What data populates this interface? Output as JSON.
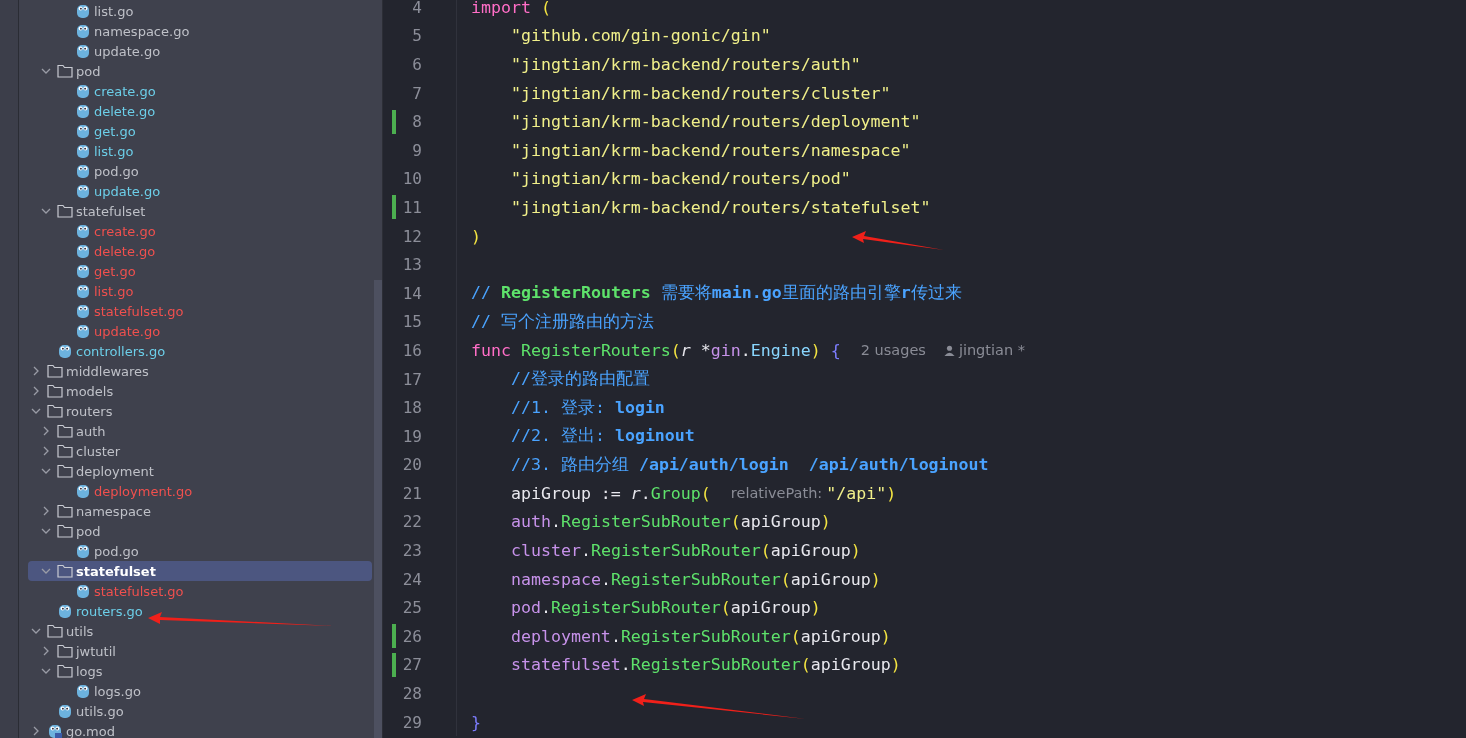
{
  "tree": {
    "items": [
      {
        "kind": "group",
        "children": [
          {
            "kind": "group",
            "children": [
              {
                "kind": "file",
                "name": "list.go",
                "color": "#bfc1c8",
                "selected": false
              },
              {
                "kind": "file",
                "name": "namespace.go",
                "color": "#bfc1c8",
                "selected": false
              },
              {
                "kind": "file",
                "name": "update.go",
                "color": "#bfc1c8",
                "selected": false
              }
            ]
          },
          {
            "kind": "folder",
            "name": "pod",
            "expanded": true,
            "selected": false,
            "children": [
              {
                "kind": "file",
                "name": "create.go",
                "color": "#6ccfe9",
                "selected": false
              },
              {
                "kind": "file",
                "name": "delete.go",
                "color": "#6ccfe9",
                "selected": false
              },
              {
                "kind": "file",
                "name": "get.go",
                "color": "#6ccfe9",
                "selected": false
              },
              {
                "kind": "file",
                "name": "list.go",
                "color": "#6ccfe9",
                "selected": false
              },
              {
                "kind": "file",
                "name": "pod.go",
                "color": "#bfc1c8",
                "selected": false
              },
              {
                "kind": "file",
                "name": "update.go",
                "color": "#6ccfe9",
                "selected": false
              }
            ]
          },
          {
            "kind": "folder",
            "name": "statefulset",
            "expanded": true,
            "selected": false,
            "children": [
              {
                "kind": "file",
                "name": "create.go",
                "color": "#f0504e",
                "selected": false
              },
              {
                "kind": "file",
                "name": "delete.go",
                "color": "#f0504e",
                "selected": false
              },
              {
                "kind": "file",
                "name": "get.go",
                "color": "#f0504e",
                "selected": false
              },
              {
                "kind": "file",
                "name": "list.go",
                "color": "#f0504e",
                "selected": false
              },
              {
                "kind": "file",
                "name": "statefulset.go",
                "color": "#f0504e",
                "selected": false
              },
              {
                "kind": "file",
                "name": "update.go",
                "color": "#f0504e",
                "selected": false
              }
            ]
          },
          {
            "kind": "file",
            "name": "controllers.go",
            "color": "#6ccfe9",
            "selected": false
          }
        ]
      },
      {
        "kind": "folder",
        "name": "middlewares",
        "expanded": false,
        "selected": false
      },
      {
        "kind": "folder",
        "name": "models",
        "expanded": false,
        "selected": false
      },
      {
        "kind": "folder",
        "name": "routers",
        "expanded": true,
        "selected": false,
        "children": [
          {
            "kind": "folder",
            "name": "auth",
            "expanded": false,
            "selected": false
          },
          {
            "kind": "folder",
            "name": "cluster",
            "expanded": false,
            "selected": false
          },
          {
            "kind": "folder",
            "name": "deployment",
            "expanded": true,
            "selected": false,
            "children": [
              {
                "kind": "file",
                "name": "deployment.go",
                "color": "#f0504e",
                "selected": false
              }
            ]
          },
          {
            "kind": "folder",
            "name": "namespace",
            "expanded": false,
            "selected": false
          },
          {
            "kind": "folder",
            "name": "pod",
            "expanded": true,
            "selected": false,
            "children": [
              {
                "kind": "file",
                "name": "pod.go",
                "color": "#bfc1c8",
                "selected": false
              }
            ]
          },
          {
            "kind": "folder",
            "name": "statefulset",
            "expanded": true,
            "selected": true,
            "children": [
              {
                "kind": "file",
                "name": "statefulset.go",
                "color": "#f0504e",
                "selected": false
              }
            ]
          },
          {
            "kind": "file",
            "name": "routers.go",
            "color": "#6ccfe9",
            "selected": false
          }
        ]
      },
      {
        "kind": "folder",
        "name": "utils",
        "expanded": true,
        "selected": false,
        "children": [
          {
            "kind": "folder",
            "name": "jwtutil",
            "expanded": false,
            "selected": false
          },
          {
            "kind": "folder",
            "name": "logs",
            "expanded": true,
            "selected": false,
            "children": [
              {
                "kind": "file",
                "name": "logs.go",
                "color": "#bfc1c8",
                "selected": false
              }
            ]
          },
          {
            "kind": "file",
            "name": "utils.go",
            "color": "#bfc1c8",
            "selected": false
          }
        ]
      },
      {
        "kind": "module",
        "name": "go.mod",
        "expanded": false,
        "selected": false
      }
    ]
  },
  "editor": {
    "lines": [
      {
        "num": "4",
        "changed": false,
        "parts": [
          {
            "kind": "code",
            "tokens": [
              {
                "t": "import ",
                "kind": "kw"
              },
              {
                "t": "(",
                "kind": "paren"
              }
            ]
          }
        ]
      },
      {
        "num": "5",
        "changed": false,
        "parts": [
          {
            "kind": "code",
            "tokens": [
              {
                "t": "    \"github.com/gin-gonic/gin\"",
                "kind": "str"
              }
            ]
          }
        ]
      },
      {
        "num": "6",
        "changed": false,
        "parts": [
          {
            "kind": "code",
            "tokens": [
              {
                "t": "    \"jingtian/krm-backend/routers/auth\"",
                "kind": "str"
              }
            ]
          }
        ]
      },
      {
        "num": "7",
        "changed": false,
        "parts": [
          {
            "kind": "code",
            "tokens": [
              {
                "t": "    \"jingtian/krm-backend/routers/cluster\"",
                "kind": "str"
              }
            ]
          }
        ]
      },
      {
        "num": "8",
        "changed": true,
        "parts": [
          {
            "kind": "code",
            "tokens": [
              {
                "t": "    \"jingtian/krm-backend/routers/deployment\"",
                "kind": "str"
              }
            ]
          }
        ]
      },
      {
        "num": "9",
        "changed": false,
        "parts": [
          {
            "kind": "code",
            "tokens": [
              {
                "t": "    \"jingtian/krm-backend/routers/namespace\"",
                "kind": "str"
              }
            ]
          }
        ]
      },
      {
        "num": "10",
        "changed": false,
        "parts": [
          {
            "kind": "code",
            "tokens": [
              {
                "t": "    \"jingtian/krm-backend/routers/pod\"",
                "kind": "str"
              }
            ]
          }
        ]
      },
      {
        "num": "11",
        "changed": true,
        "parts": [
          {
            "kind": "code",
            "tokens": [
              {
                "t": "    \"jingtian/krm-backend/routers/statefulset\"",
                "kind": "str"
              }
            ]
          }
        ]
      },
      {
        "num": "12",
        "changed": false,
        "parts": [
          {
            "kind": "code",
            "tokens": [
              {
                "t": ")",
                "kind": "paren"
              }
            ]
          }
        ]
      },
      {
        "num": "13",
        "changed": false
      },
      {
        "num": "14",
        "changed": false,
        "parts": [
          {
            "kind": "code",
            "tokens": [
              {
                "t": "// ",
                "kind": "cm"
              },
              {
                "t": "RegisterRouters",
                "kind": "cmg"
              },
              {
                "t": " 需要将",
                "kind": "cm"
              },
              {
                "t": "main.go",
                "kind": "cmb"
              },
              {
                "t": "里面的路由引擎",
                "kind": "cm"
              },
              {
                "t": "r",
                "kind": "cmb"
              },
              {
                "t": "传过来",
                "kind": "cm"
              }
            ]
          }
        ]
      },
      {
        "num": "15",
        "changed": false,
        "parts": [
          {
            "kind": "code",
            "tokens": [
              {
                "t": "// 写个注册路由的方法",
                "kind": "cm"
              }
            ]
          }
        ]
      },
      {
        "num": "16",
        "changed": false,
        "parts": [
          {
            "kind": "code",
            "tokens": [
              {
                "t": "func ",
                "kind": "kw"
              },
              {
                "t": "RegisterRouters",
                "kind": "fn"
              },
              {
                "t": "(",
                "kind": "paren"
              },
              {
                "t": "r",
                "kind": "param"
              },
              {
                "t": " *",
                "kind": "plain"
              },
              {
                "t": "gin",
                "kind": "pkg"
              },
              {
                "t": ".",
                "kind": "plain"
              },
              {
                "t": "Engine",
                "kind": "type"
              },
              {
                "t": ")",
                "kind": "paren"
              },
              {
                "t": " {",
                "kind": "brace"
              }
            ]
          },
          {
            "kind": "hint",
            "text": "2 usages"
          },
          {
            "kind": "author",
            "text": "jingtian *"
          }
        ]
      },
      {
        "num": "17",
        "changed": false,
        "parts": [
          {
            "kind": "code",
            "tokens": [
              {
                "t": "    //登录的路由配置",
                "kind": "cm"
              }
            ]
          }
        ]
      },
      {
        "num": "18",
        "changed": false,
        "parts": [
          {
            "kind": "code",
            "tokens": [
              {
                "t": "    //1. 登录: ",
                "kind": "cm"
              },
              {
                "t": "login",
                "kind": "cmb"
              }
            ]
          }
        ]
      },
      {
        "num": "19",
        "changed": false,
        "parts": [
          {
            "kind": "code",
            "tokens": [
              {
                "t": "    //2. 登出: ",
                "kind": "cm"
              },
              {
                "t": "loginout",
                "kind": "cmb"
              }
            ]
          }
        ]
      },
      {
        "num": "20",
        "changed": false,
        "parts": [
          {
            "kind": "code",
            "tokens": [
              {
                "t": "    //3. 路由分组 ",
                "kind": "cm"
              },
              {
                "t": "/api/auth/login  /api/auth/loginout",
                "kind": "cmb"
              }
            ]
          }
        ]
      },
      {
        "num": "21",
        "changed": false,
        "parts": [
          {
            "kind": "code",
            "tokens": [
              {
                "t": "    apiGroup := ",
                "kind": "plain"
              },
              {
                "t": "r",
                "kind": "param"
              },
              {
                "t": ".",
                "kind": "plain"
              },
              {
                "t": "Group",
                "kind": "fn"
              },
              {
                "t": "(",
                "kind": "paren"
              }
            ]
          },
          {
            "kind": "hint",
            "text": "relativePath:"
          },
          {
            "kind": "code",
            "tokens": [
              {
                "t": "\"/api\"",
                "kind": "str"
              },
              {
                "t": ")",
                "kind": "paren"
              }
            ]
          }
        ]
      },
      {
        "num": "22",
        "changed": false,
        "parts": [
          {
            "kind": "code",
            "tokens": [
              {
                "t": "    auth",
                "kind": "pkg"
              },
              {
                "t": ".",
                "kind": "plain"
              },
              {
                "t": "RegisterSubRouter",
                "kind": "fn"
              },
              {
                "t": "(",
                "kind": "paren"
              },
              {
                "t": "apiGroup",
                "kind": "plain"
              },
              {
                "t": ")",
                "kind": "paren"
              }
            ]
          }
        ]
      },
      {
        "num": "23",
        "changed": false,
        "parts": [
          {
            "kind": "code",
            "tokens": [
              {
                "t": "    cluster",
                "kind": "pkg"
              },
              {
                "t": ".",
                "kind": "plain"
              },
              {
                "t": "RegisterSubRouter",
                "kind": "fn"
              },
              {
                "t": "(",
                "kind": "paren"
              },
              {
                "t": "apiGroup",
                "kind": "plain"
              },
              {
                "t": ")",
                "kind": "paren"
              }
            ]
          }
        ]
      },
      {
        "num": "24",
        "changed": false,
        "parts": [
          {
            "kind": "code",
            "tokens": [
              {
                "t": "    namespace",
                "kind": "pkg"
              },
              {
                "t": ".",
                "kind": "plain"
              },
              {
                "t": "RegisterSubRouter",
                "kind": "fn"
              },
              {
                "t": "(",
                "kind": "paren"
              },
              {
                "t": "apiGroup",
                "kind": "plain"
              },
              {
                "t": ")",
                "kind": "paren"
              }
            ]
          }
        ]
      },
      {
        "num": "25",
        "changed": false,
        "parts": [
          {
            "kind": "code",
            "tokens": [
              {
                "t": "    pod",
                "kind": "pkg"
              },
              {
                "t": ".",
                "kind": "plain"
              },
              {
                "t": "RegisterSubRouter",
                "kind": "fn"
              },
              {
                "t": "(",
                "kind": "paren"
              },
              {
                "t": "apiGroup",
                "kind": "plain"
              },
              {
                "t": ")",
                "kind": "paren"
              }
            ]
          }
        ]
      },
      {
        "num": "26",
        "changed": true,
        "parts": [
          {
            "kind": "code",
            "tokens": [
              {
                "t": "    deployment",
                "kind": "pkg"
              },
              {
                "t": ".",
                "kind": "plain"
              },
              {
                "t": "RegisterSubRouter",
                "kind": "fn"
              },
              {
                "t": "(",
                "kind": "paren"
              },
              {
                "t": "apiGroup",
                "kind": "plain"
              },
              {
                "t": ")",
                "kind": "paren"
              }
            ]
          }
        ]
      },
      {
        "num": "27",
        "changed": true,
        "parts": [
          {
            "kind": "code",
            "tokens": [
              {
                "t": "    statefulset",
                "kind": "pkg"
              },
              {
                "t": ".",
                "kind": "plain"
              },
              {
                "t": "RegisterSubRouter",
                "kind": "fn"
              },
              {
                "t": "(",
                "kind": "paren"
              },
              {
                "t": "apiGroup",
                "kind": "plain"
              },
              {
                "t": ")",
                "kind": "paren"
              }
            ]
          }
        ]
      },
      {
        "num": "28",
        "changed": false
      },
      {
        "num": "29",
        "changed": false,
        "parts": [
          {
            "kind": "code",
            "tokens": [
              {
                "t": "}",
                "kind": "brace"
              }
            ]
          }
        ]
      }
    ]
  }
}
